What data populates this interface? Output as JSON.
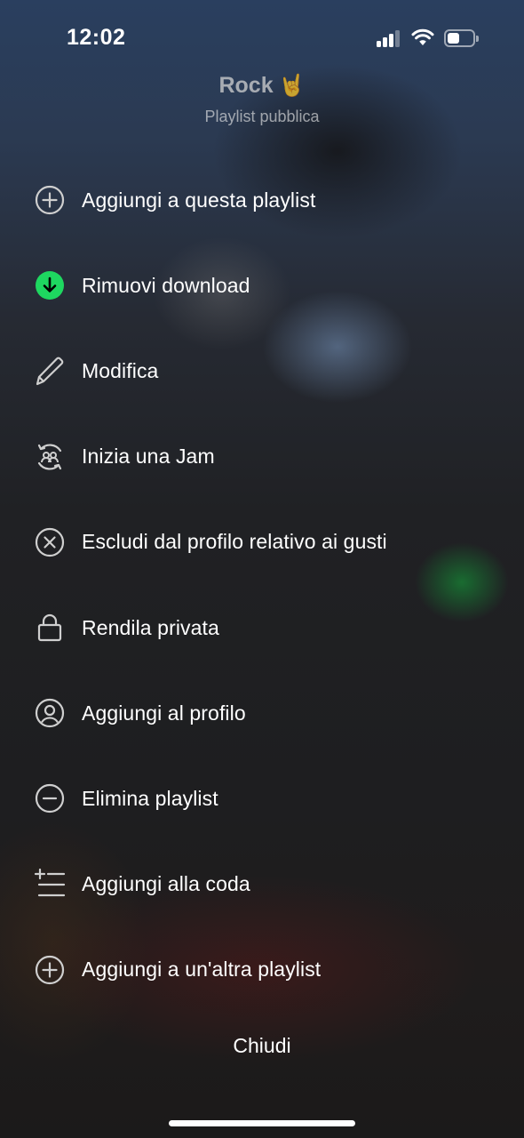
{
  "status_bar": {
    "time": "12:02"
  },
  "header": {
    "title": "Rock",
    "title_emoji": "🤘",
    "subtitle": "Playlist pubblica"
  },
  "menu": {
    "items": [
      {
        "label": "Aggiungi a questa playlist",
        "icon": "plus-circle-icon"
      },
      {
        "label": "Rimuovi download",
        "icon": "download-done-icon"
      },
      {
        "label": "Modifica",
        "icon": "pencil-icon"
      },
      {
        "label": "Inizia una Jam",
        "icon": "jam-icon"
      },
      {
        "label": "Escludi dal profilo relativo ai gusti",
        "icon": "x-circle-icon"
      },
      {
        "label": "Rendila privata",
        "icon": "lock-icon"
      },
      {
        "label": "Aggiungi al profilo",
        "icon": "profile-icon"
      },
      {
        "label": "Elimina playlist",
        "icon": "minus-circle-icon"
      },
      {
        "label": "Aggiungi alla coda",
        "icon": "add-to-queue-icon"
      },
      {
        "label": "Aggiungi a un'altra playlist",
        "icon": "plus-circle-icon"
      }
    ]
  },
  "footer": {
    "close_label": "Chiudi"
  },
  "colors": {
    "accent_green": "#1ed760",
    "text": "#ffffff",
    "subtitle": "#b3b3b3"
  }
}
